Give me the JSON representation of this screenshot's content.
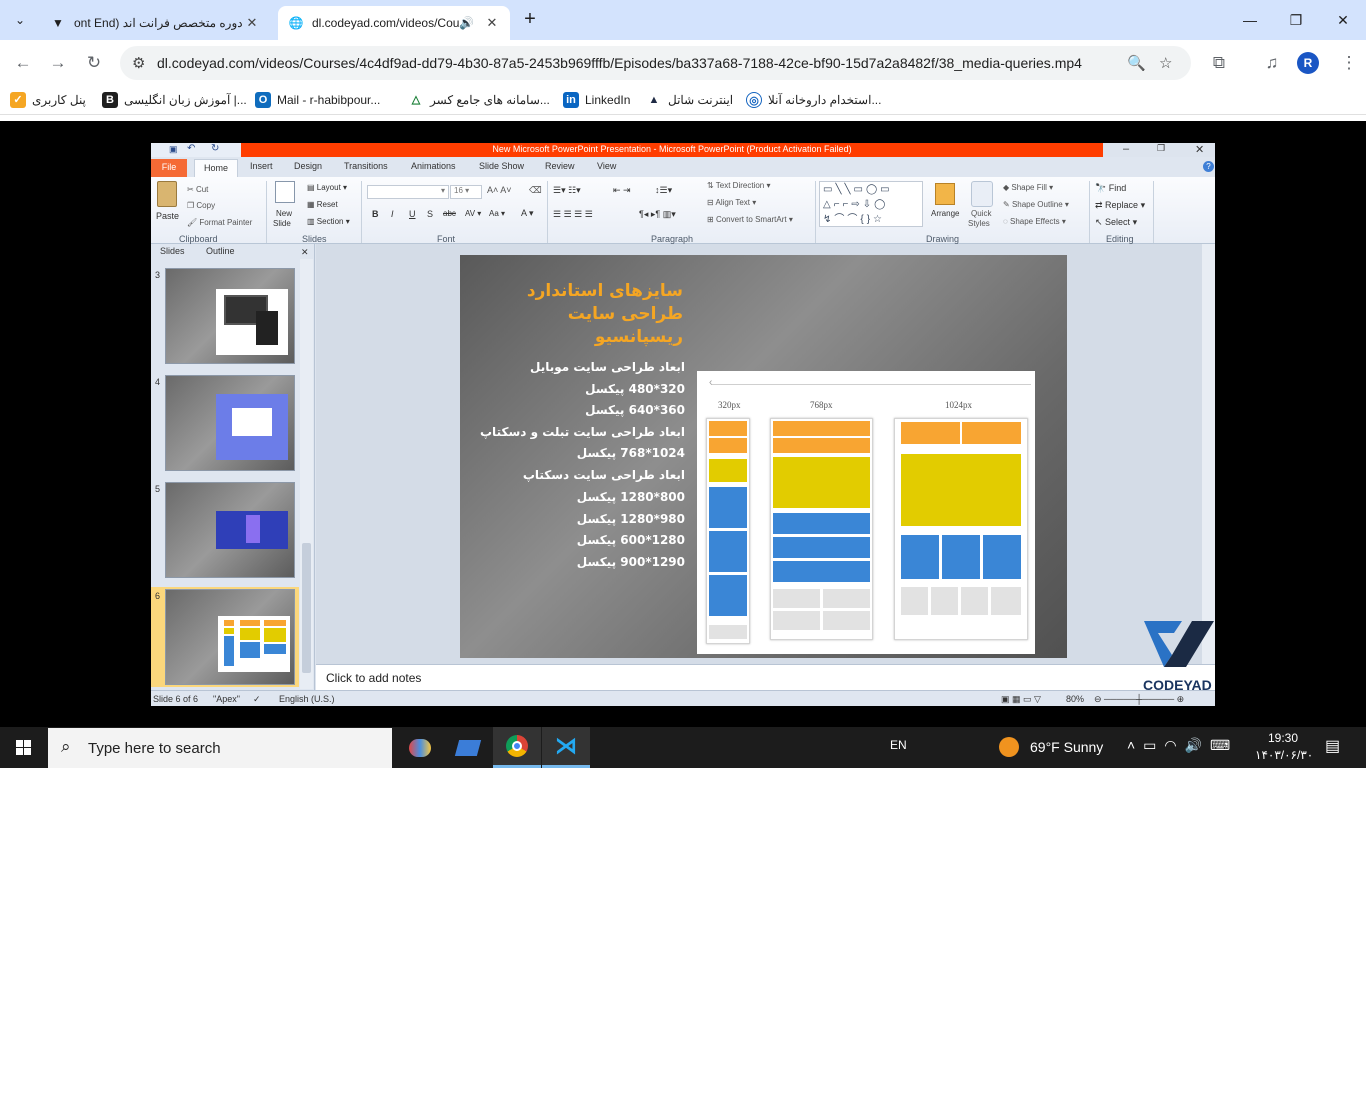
{
  "browser": {
    "tabs": [
      {
        "title": "دوره متخصص فرانت اند (Front End",
        "shown": "دوره متخصص فرانت اند (ont End",
        "active": false
      },
      {
        "title": "dl.codeyad.com/videos/Cou",
        "active": true
      }
    ],
    "url": "dl.codeyad.com/videos/Courses/4c4df9ad-dd79-4b30-87a5-2453b969fffb/Episodes/ba337a68-7188-42ce-bf90-15d7a2a8482f/38_media-queries.mp4",
    "profile_initial": "R",
    "bookmarks": [
      {
        "label": "پنل کاربری",
        "color": "#f5a623"
      },
      {
        "label": "آموزش زبان انگلیسی |...",
        "color": "#1f1f1f"
      },
      {
        "label": "Mail - r-habibpour...",
        "color": "#0f6cbd"
      },
      {
        "label": "سامانه های جامع کسر...",
        "color": "#1a7f37"
      },
      {
        "label": "LinkedIn",
        "color": "#0a66c2"
      },
      {
        "label": "اینترنت شاتل",
        "color": "#1f2a44"
      },
      {
        "label": "استخدام داروخانه آنلا...",
        "color": "#1565c0"
      }
    ]
  },
  "ppt": {
    "window_title": "New Microsoft PowerPoint Presentation - Microsoft PowerPoint (Product Activation Failed)",
    "ribbon_tabs": [
      "File",
      "Home",
      "Insert",
      "Design",
      "Transitions",
      "Animations",
      "Slide Show",
      "Review",
      "View"
    ],
    "clipboard": {
      "paste": "Paste",
      "cut": "Cut",
      "copy": "Copy",
      "format_painter": "Format Painter",
      "group": "Clipboard"
    },
    "slides_group": {
      "new_slide_1": "New",
      "new_slide_2": "Slide",
      "layout": "Layout",
      "reset": "Reset",
      "section": "Section",
      "group": "Slides"
    },
    "font_group": {
      "size": "16",
      "group": "Font"
    },
    "paragraph_group": {
      "text_direction": "Text Direction",
      "align_text": "Align Text",
      "convert": "Convert to SmartArt",
      "group": "Paragraph"
    },
    "drawing_group": {
      "arrange": "Arrange",
      "quick_styles_1": "Quick",
      "quick_styles_2": "Styles",
      "shape_fill": "Shape Fill",
      "shape_outline": "Shape Outline",
      "shape_effects": "Shape Effects",
      "group": "Drawing"
    },
    "editing_group": {
      "find": "Find",
      "replace": "Replace",
      "select": "Select",
      "group": "Editing"
    },
    "pane_tabs": [
      "Slides",
      "Outline"
    ],
    "thumb_numbers": [
      "3",
      "4",
      "5",
      "6"
    ],
    "slide": {
      "title_lines": [
        "سایزهای استاندارد",
        "طراحی سایت",
        "ریسپانسیو"
      ],
      "body_lines": [
        "ابعاد طراحی سایت موبایل",
        "320*480 پیکسل",
        "360*640 پیکسل",
        "ابعاد طراحی سایت تبلت و دسکتاپ",
        "1024*768 پیکسل",
        "ابعاد طراحی سایت دسکتاپ",
        "800*1280 پیکسل",
        "980*1280 پیکسل",
        "1280*600 پیکسل",
        "1290*900 پیکسل"
      ],
      "diagram_labels": [
        "320px",
        "768px",
        "1024px"
      ]
    },
    "notes_placeholder": "Click to add notes",
    "status": {
      "slide_of": "Slide 6 of 6",
      "theme": "\"Apex\"",
      "language": "English (U.S.)",
      "zoom": "80%"
    },
    "logo_text": "CODEYAD"
  },
  "taskbar": {
    "search_placeholder": "Type here to search",
    "lang": "EN",
    "weather": "69°F  Sunny",
    "time": "19:30",
    "date": "۱۴۰۳/۰۶/۳۰"
  }
}
